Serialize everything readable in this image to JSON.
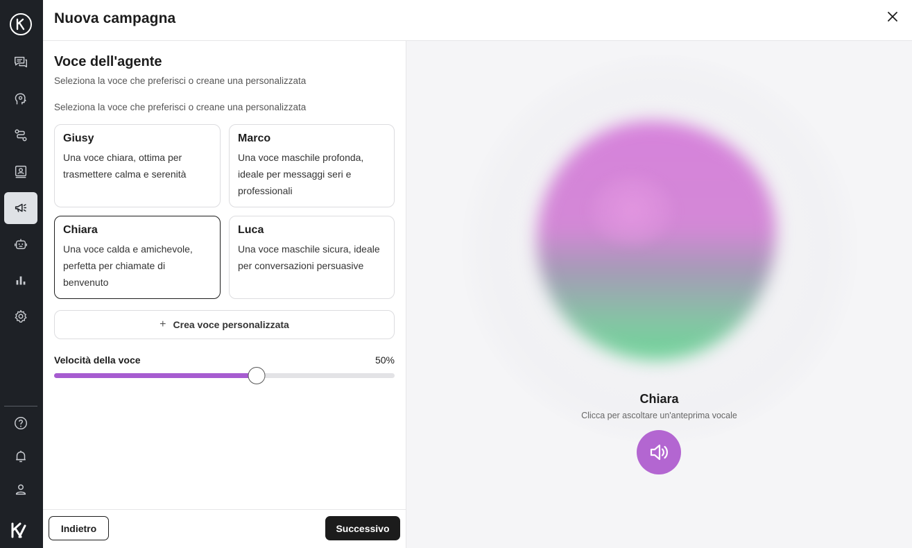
{
  "header": {
    "title": "Nuova campagna"
  },
  "sidebar": {
    "items": [
      {
        "name": "conversations",
        "icon": "chat-bubbles-icon"
      },
      {
        "name": "knowledge",
        "icon": "head-gear-icon"
      },
      {
        "name": "integrations",
        "icon": "route-icon"
      },
      {
        "name": "contacts",
        "icon": "contact-card-icon"
      },
      {
        "name": "campaigns",
        "icon": "megaphone-icon",
        "active": true
      },
      {
        "name": "agents",
        "icon": "robot-icon"
      },
      {
        "name": "analytics",
        "icon": "bar-chart-icon"
      },
      {
        "name": "settings",
        "icon": "gear-icon"
      }
    ],
    "bottom": [
      {
        "name": "help",
        "icon": "help-circle-icon"
      },
      {
        "name": "notifications",
        "icon": "bell-icon"
      },
      {
        "name": "profile",
        "icon": "user-icon"
      }
    ]
  },
  "section": {
    "title": "Voce dell'agente",
    "subtitle": "Seleziona la voce che preferisci o creane una personalizzata",
    "subtitle2": "Seleziona la voce che preferisci o creane una personalizzata"
  },
  "voices": [
    {
      "name": "Giusy",
      "description": "Una voce chiara, ottima per trasmettere calma e serenità",
      "selected": false
    },
    {
      "name": "Marco",
      "description": "Una voce maschile profonda, ideale per messaggi seri e professionali",
      "selected": false
    },
    {
      "name": "Chiara",
      "description": "Una voce calda e amichevole, perfetta per chiamate di benvenuto",
      "selected": true
    },
    {
      "name": "Luca",
      "description": "Una voce maschile sicura, ideale per conversazioni persuasive",
      "selected": false
    }
  ],
  "custom_voice": {
    "label": "Crea voce personalizzata",
    "icon": "plus-icon"
  },
  "speed": {
    "label": "Velocità della voce",
    "value_text": "50%",
    "value": 0.5
  },
  "footer": {
    "back_label": "Indietro",
    "next_label": "Successivo"
  },
  "preview": {
    "name": "Chiara",
    "hint": "Clicca per ascoltare un'anteprima vocale",
    "play_icon": "speaker-icon"
  },
  "colors": {
    "accent": "#a65cd0",
    "play_button": "#b366d1",
    "sidebar_bg": "#1e2126",
    "primary_button": "#1c1c1c"
  }
}
